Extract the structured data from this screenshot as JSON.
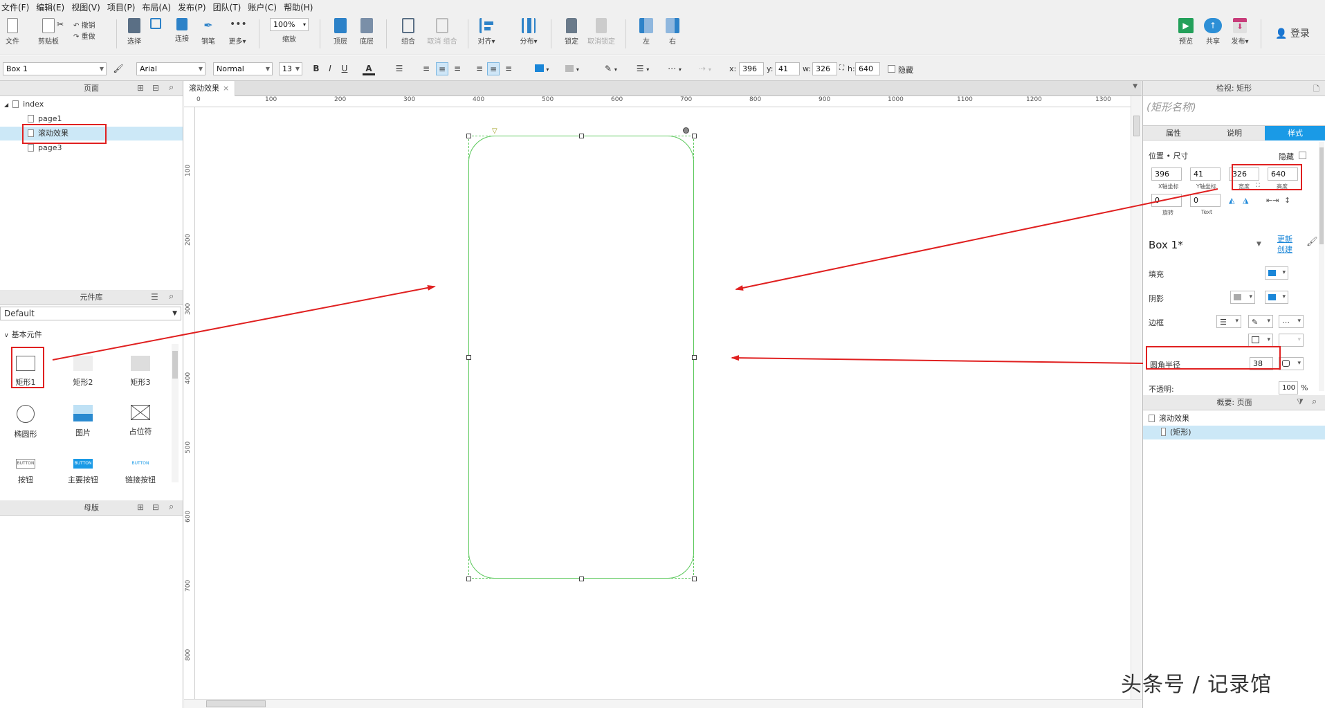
{
  "menu": [
    "文件(F)",
    "编辑(E)",
    "视图(V)",
    "项目(P)",
    "布局(A)",
    "发布(P)",
    "团队(T)",
    "账户(C)",
    "帮助(H)"
  ],
  "toolbar": {
    "file": "文件",
    "clipboard": "剪贴板",
    "cut": "剪切",
    "copy": "复制",
    "undo": "撤销",
    "redo": "重做",
    "select": "选择",
    "connect": "连接",
    "pen": "钢笔",
    "more": "更多▾",
    "zoom_value": "100%",
    "zoom": "缩放",
    "top": "顶层",
    "bottom": "底层",
    "group": "组合",
    "ungroup": "取消 组合",
    "align": "对齐▾",
    "distribute": "分布▾",
    "lock": "锁定",
    "unlock": "取消锁定",
    "left": "左",
    "right": "右",
    "preview": "预览",
    "share": "共享",
    "publish": "发布▾",
    "login": "登录"
  },
  "format": {
    "widget_name": "Box 1",
    "font": "Arial",
    "style": "Normal",
    "size": "13",
    "bold": "B",
    "italic": "I",
    "underline": "U",
    "text_color": "A",
    "x_label": "x:",
    "x": "396",
    "y_label": "y:",
    "y": "41",
    "w_label": "w:",
    "w": "326",
    "h_label": "h:",
    "h": "640",
    "hide": "隐藏"
  },
  "pages_panel": {
    "title": "页面",
    "root": "index",
    "pages": [
      "page1",
      "滚动效果",
      "page3"
    ],
    "selected": 1
  },
  "library_panel": {
    "title": "元件库",
    "library": "Default",
    "group": "基本元件",
    "widgets": [
      {
        "label": "矩形1",
        "icon": "rect-icon"
      },
      {
        "label": "矩形2",
        "icon": "rect-gray-icon"
      },
      {
        "label": "矩形3",
        "icon": "rect-gray-icon"
      },
      {
        "label": "椭圆形",
        "icon": "ellipse-icon"
      },
      {
        "label": "图片",
        "icon": "image-icon"
      },
      {
        "label": "占位符",
        "icon": "placeholder-icon"
      },
      {
        "label": "按钮",
        "icon": "button-icon",
        "glyph": "BUTTON"
      },
      {
        "label": "主要按钮",
        "icon": "primary-button-icon",
        "glyph": "BUTTON"
      },
      {
        "label": "链接按钮",
        "icon": "link-button-icon",
        "glyph": "BUTTON"
      }
    ]
  },
  "masters_panel": {
    "title": "母版"
  },
  "canvas": {
    "tab": "滚动效果",
    "hruler": [
      "0",
      "100",
      "200",
      "300",
      "400",
      "500",
      "600",
      "700",
      "800",
      "900",
      "1000",
      "1100",
      "1200",
      "1300"
    ],
    "vruler": [
      "100",
      "200",
      "300",
      "400",
      "500",
      "600",
      "700",
      "800"
    ]
  },
  "inspector": {
    "title": "检视: 矩形",
    "name_placeholder": "(矩形名称)",
    "tabs": [
      "属性",
      "说明",
      "样式"
    ],
    "active_tab": 2,
    "section": "位置 • 尺寸",
    "hide": "隐藏",
    "x": "396",
    "x_label": "X轴坐标",
    "y": "41",
    "y_label": "Y轴坐标",
    "w": "326",
    "w_label": "宽度",
    "h": "640",
    "h_label": "高度",
    "rotate": "0",
    "rotate_label": "旋转",
    "text_rotate": "0",
    "text_label": "Text",
    "style_name": "Box 1*",
    "update": "更新",
    "create": "创建",
    "fill": "填充",
    "shadow": "阴影",
    "border": "边框",
    "radius_label": "圆角半径",
    "radius": "38",
    "opacity_label": "不透明:",
    "opacity": "100",
    "percent": "%"
  },
  "outline_panel": {
    "title": "概要: 页面",
    "page": "滚动效果",
    "item": "(矩形)"
  },
  "watermark": "头条号 / 记录馆",
  "colors": {
    "accent": "#1a9ae6",
    "selection": "#cce8f7",
    "annotation": "#e02020",
    "shape_border": "#5ac85a"
  }
}
